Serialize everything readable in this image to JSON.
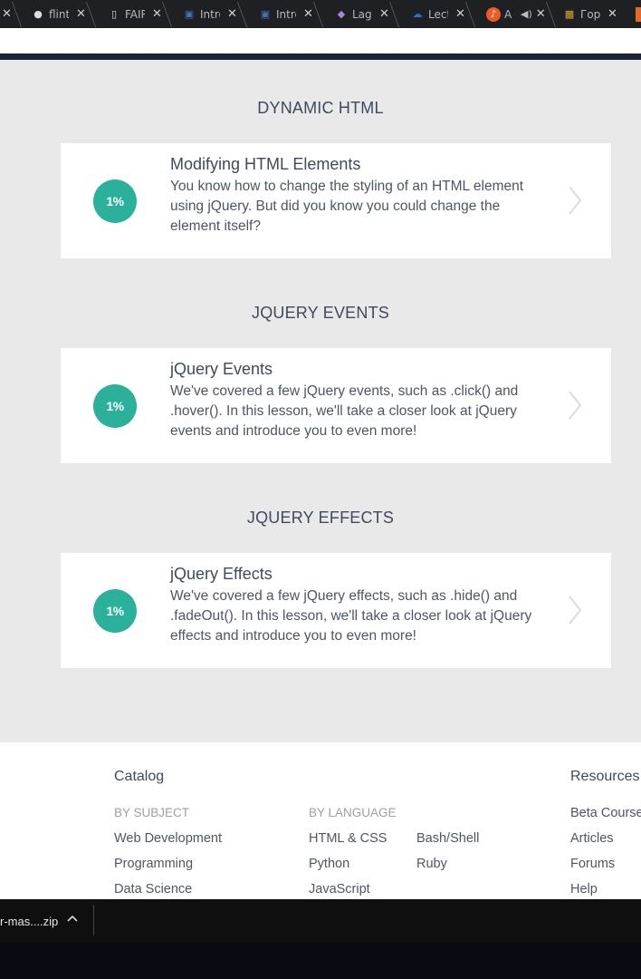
{
  "tabs": [
    {
      "label": "",
      "icon": "close-icon"
    },
    {
      "label": "flint",
      "icon": "github-icon"
    },
    {
      "label": "FAIR",
      "icon": "document-icon"
    },
    {
      "label": "Intro",
      "icon": "page-icon"
    },
    {
      "label": "Intro",
      "icon": "page-icon"
    },
    {
      "label": "Lago",
      "icon": "cube-icon"
    },
    {
      "label": "Lect",
      "icon": "cloud-icon"
    },
    {
      "label": "A",
      "icon": "music-icon"
    },
    {
      "label": "Гор",
      "icon": "box-icon"
    }
  ],
  "sections": [
    {
      "heading": "DYNAMIC HTML",
      "lesson": {
        "progress": "1%",
        "title": "Modifying HTML Elements",
        "desc": "You know how to change the styling of an HTML element using jQuery. But did you know you could change the element itself?"
      }
    },
    {
      "heading": "JQUERY EVENTS",
      "lesson": {
        "progress": "1%",
        "title": "jQuery Events",
        "desc": "We've covered a few jQuery events, such as .click() and .hover(). In this lesson, we'll take a closer look at jQuery events and introduce you to even more!"
      }
    },
    {
      "heading": "JQUERY EFFECTS",
      "lesson": {
        "progress": "1%",
        "title": "jQuery Effects",
        "desc": "We've covered a few jQuery effects, such as .hide() and .fadeOut(). In this lesson, we'll take a closer look at jQuery effects and introduce you to even more!"
      }
    }
  ],
  "footer": {
    "catalog": "Catalog",
    "by_subject": "BY SUBJECT",
    "subjects": [
      "Web Development",
      "Programming",
      "Data Science"
    ],
    "by_language": "BY LANGUAGE",
    "languages_col1": [
      "HTML & CSS",
      "Python",
      "JavaScript"
    ],
    "languages_col2": [
      "Bash/Shell",
      "Ruby"
    ],
    "resources": "Resources",
    "resource_links": [
      "Beta Courses",
      "Articles",
      "Forums",
      "Help"
    ]
  },
  "download": {
    "filename": "r-mas....zip"
  },
  "colors": {
    "accent": "#2ab09b",
    "page_bg": "#e9e9e9",
    "heading": "#3f4a5e"
  }
}
